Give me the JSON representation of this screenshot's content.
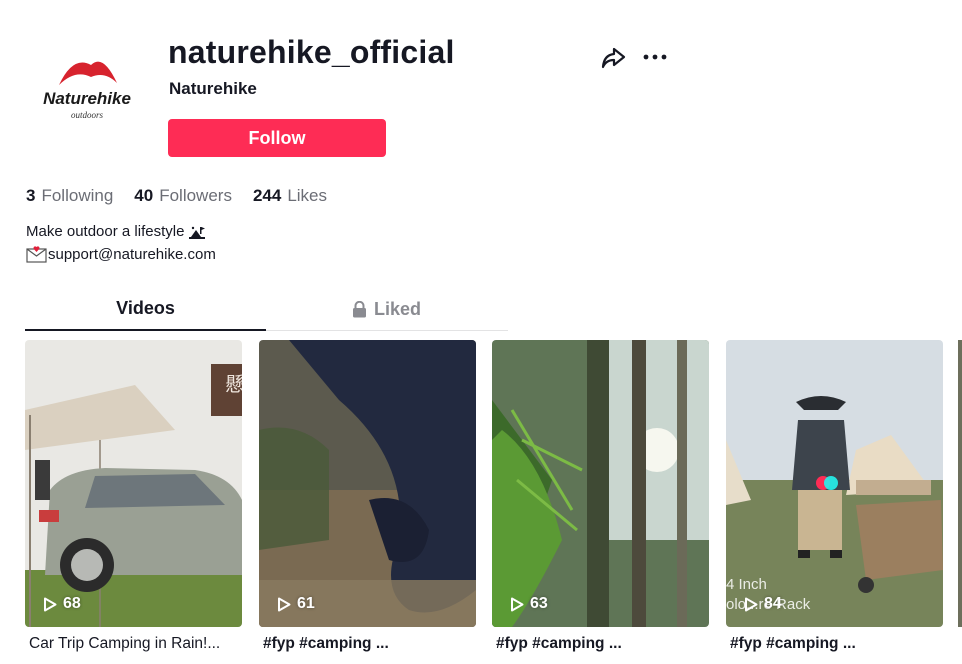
{
  "profile": {
    "username": "naturehike_official",
    "nickname": "Naturehike",
    "logo_text": "Naturehike",
    "logo_subtext": "outdoors",
    "follow_label": "Follow"
  },
  "stats": [
    {
      "value": "3",
      "label": "Following"
    },
    {
      "value": "40",
      "label": "Followers"
    },
    {
      "value": "244",
      "label": "Likes"
    }
  ],
  "bio": {
    "line1": "Make outdoor a lifestyle",
    "line1_icon": "camping-icon",
    "line2": "support@naturehike.com",
    "line2_icon": "envelope-icon"
  },
  "tabs": {
    "videos": "Videos",
    "liked": "Liked"
  },
  "videos": [
    {
      "views": "68",
      "caption": "Car Trip Camping in Rain!...",
      "overlay": "懸"
    },
    {
      "views": "61",
      "caption": "#fyp #camping ..."
    },
    {
      "views": "63",
      "caption": "#fyp #camping ..."
    },
    {
      "views": "84",
      "caption": "#fyp #camping ...",
      "overlay_line1": "4 Inch",
      "overlay_line2": "olo...re Rack"
    }
  ],
  "colors": {
    "follow": "#fe2c55",
    "text_primary": "#161823",
    "text_secondary": "#6b6d75"
  }
}
